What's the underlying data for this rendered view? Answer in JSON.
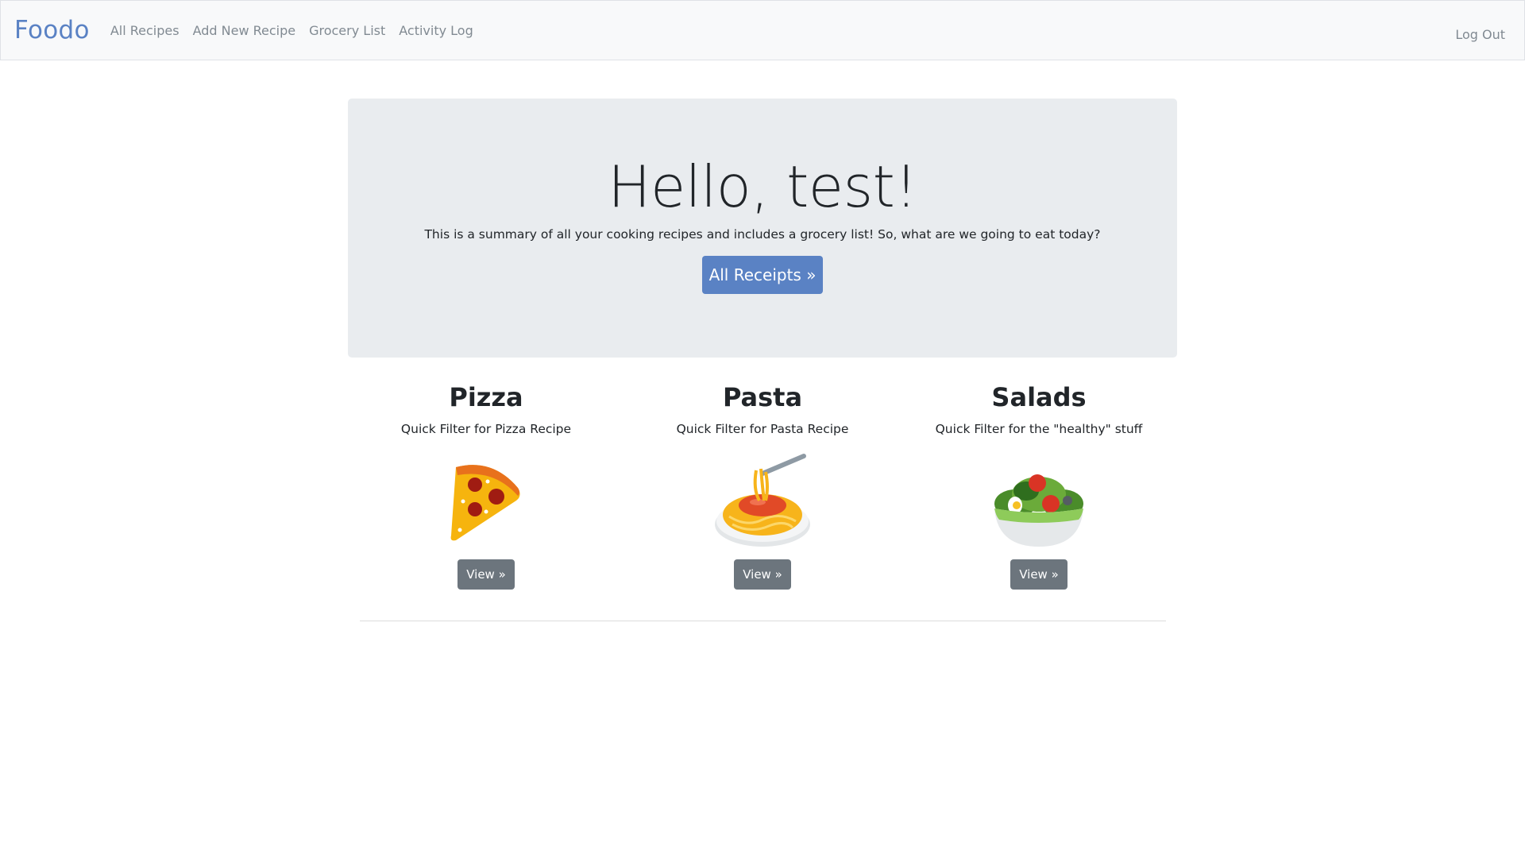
{
  "nav": {
    "brand": "Foodo",
    "links": [
      "All Recipes",
      "Add New Recipe",
      "Grocery List",
      "Activity Log"
    ],
    "logout": "Log Out"
  },
  "hero": {
    "title": "Hello, test!",
    "subtitle": "This is a summary of all your cooking recipes and includes a grocery list! So, what are we going to eat today?",
    "button": "All Receipts »"
  },
  "cards": [
    {
      "title": "Pizza",
      "desc": "Quick Filter for Pizza Recipe",
      "icon": "pizza-icon",
      "button": "View »"
    },
    {
      "title": "Pasta",
      "desc": "Quick Filter for Pasta Recipe",
      "icon": "spaghetti-icon",
      "button": "View »"
    },
    {
      "title": "Salads",
      "desc": "Quick Filter for the \"healthy\" stuff",
      "icon": "salad-icon",
      "button": "View »"
    }
  ],
  "colors": {
    "brand": "#5a82c4",
    "navbar_bg": "#f8f9fa",
    "jumbotron_bg": "#e9ecef",
    "secondary_button": "#6c757d"
  }
}
